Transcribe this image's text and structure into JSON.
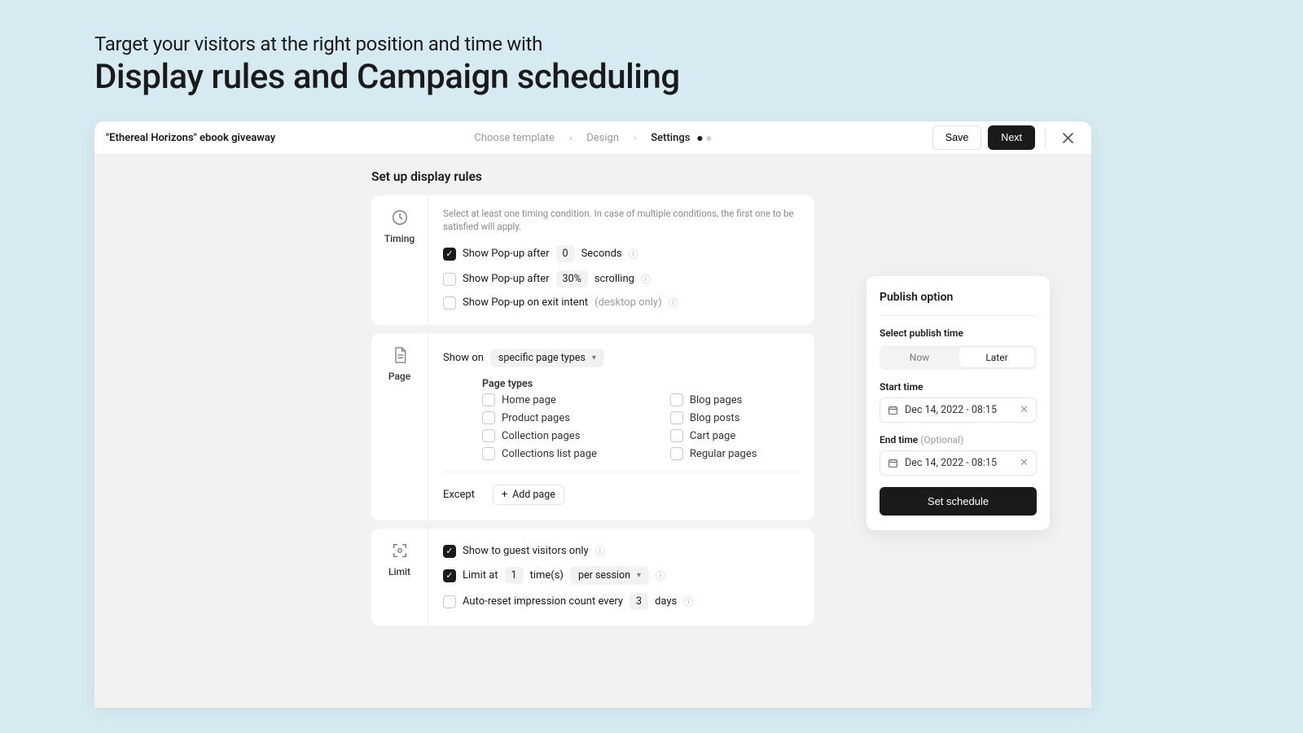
{
  "hero": {
    "subtitle": "Target your visitors at the right position and time with",
    "title": "Display rules and Campaign scheduling"
  },
  "topbar": {
    "title": "\"Ethereal Horizons\" ebook giveaway",
    "steps": [
      "Choose template",
      "Design",
      "Settings"
    ],
    "save": "Save",
    "next": "Next"
  },
  "setup": {
    "title": "Set up display rules",
    "timing": {
      "label": "Timing",
      "hint": "Select at least one timing condition. In case of multiple conditions, the first one to be satisfied will apply.",
      "row1_a": "Show Pop-up after",
      "row1_val": "0",
      "row1_b": "Seconds",
      "row2_a": "Show Pop-up after",
      "row2_val": "30%",
      "row2_b": "scrolling",
      "row3_a": "Show Pop-up on exit intent",
      "row3_b": "(desktop only)"
    },
    "page": {
      "label": "Page",
      "show_on": "Show on",
      "select_val": "specific page types",
      "ptypes_label": "Page types",
      "left": [
        "Home page",
        "Product pages",
        "Collection pages",
        "Collections list page"
      ],
      "right": [
        "Blog pages",
        "Blog posts",
        "Cart page",
        "Regular pages"
      ],
      "except": "Except",
      "add_page": "Add page"
    },
    "limit": {
      "label": "Limit",
      "row1": "Show to guest visitors only",
      "row2_a": "Limit at",
      "row2_val": "1",
      "row2_b": "time(s)",
      "row2_sel": "per session",
      "row3_a": "Auto-reset impression count every",
      "row3_val": "3",
      "row3_b": "days"
    }
  },
  "panel": {
    "title": "Publish option",
    "select_time": "Select publish time",
    "now": "Now",
    "later": "Later",
    "start": "Start time",
    "end": "End time",
    "optional": "(Optional)",
    "date1": "Dec 14, 2022 - 08:15",
    "date2": "Dec 14, 2022 - 08:15",
    "set": "Set schedule"
  }
}
